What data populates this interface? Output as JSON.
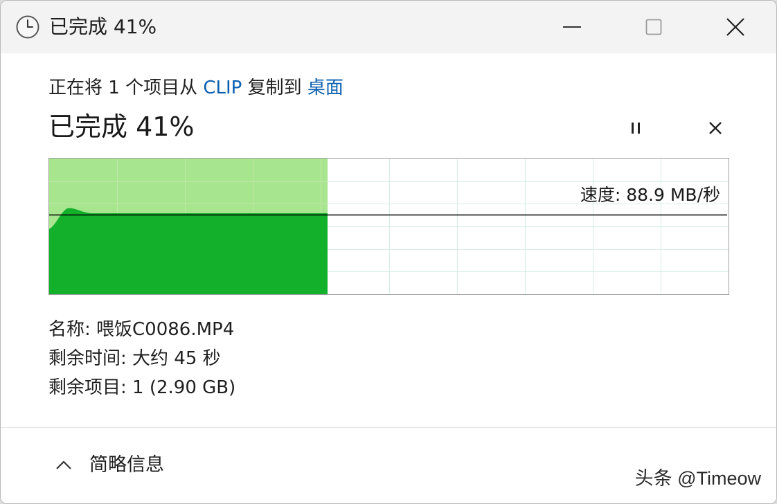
{
  "window": {
    "title": "已完成 41%",
    "icon": "clock-icon"
  },
  "titlebar_buttons": {
    "minimize_icon": "minimize-icon",
    "maximize_icon": "maximize-icon",
    "close_icon": "close-icon"
  },
  "copy_line": {
    "prefix": "正在将 1 个项目从 ",
    "source": "CLIP",
    "middle": " 复制到 ",
    "destination": "桌面"
  },
  "progress": {
    "label": "已完成 41%",
    "fraction": 0.41
  },
  "controls": {
    "pause_icon": "pause-icon",
    "cancel_icon": "close-icon"
  },
  "graph": {
    "speed_text": "速度: 88.9 MB/秒",
    "fill_light": "#a8e58f",
    "fill_dark": "#13b02c",
    "grid_color": "#d6ece6",
    "line_color": "#000000"
  },
  "details": {
    "name": "名称: 喂饭C0086.MP4",
    "time_remaining": "剩余时间: 大约 45 秒",
    "items_remaining": "剩余项目: 1 (2.90 GB)"
  },
  "footer": {
    "toggle_label": "简略信息",
    "toggle_icon": "chevron-up-icon"
  },
  "watermark": "头条 @Timeow"
}
